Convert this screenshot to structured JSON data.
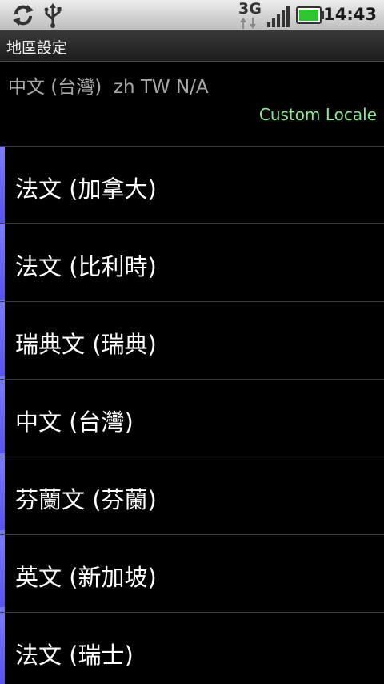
{
  "status_bar": {
    "network_type": "3G",
    "time": "14:43",
    "icons": [
      "sync-icon",
      "usb-icon",
      "data-arrows-icon",
      "signal-icon",
      "battery-icon"
    ]
  },
  "title_bar": {
    "title": "地區設定"
  },
  "header": {
    "current_locale": "中文 (台灣)  zh TW N/A",
    "custom_locale_label": "Custom Locale",
    "accent_color": "#8ee88e"
  },
  "locale_list": {
    "items": [
      {
        "label": "法文 (加拿大)"
      },
      {
        "label": "法文 (比利時)"
      },
      {
        "label": "瑞典文 (瑞典)"
      },
      {
        "label": "中文 (台灣)"
      },
      {
        "label": "芬蘭文 (芬蘭)"
      },
      {
        "label": "英文 (新加坡)"
      },
      {
        "label": "法文 (瑞士)"
      }
    ]
  }
}
